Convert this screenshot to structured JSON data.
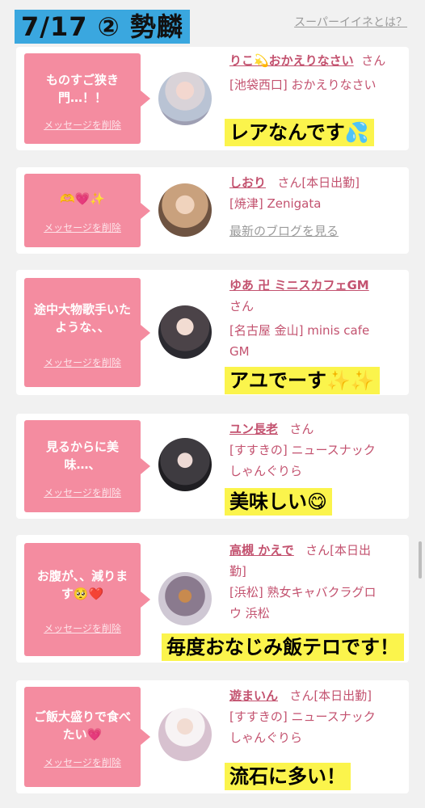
{
  "header": {
    "title": "7/17 ② 勢麟",
    "link": "スーパーイイネとは？"
  },
  "delete_label": "メッセージを削除",
  "cards": [
    {
      "message_lines": [
        "ものすご狭き",
        "門…！！"
      ],
      "name": "りこ💫おかえりなさい",
      "san": "さん",
      "shop_lines": [
        "[池袋西口] おかえりなさい"
      ],
      "blog": "",
      "highlight": "レアなんです💦"
    },
    {
      "message_lines": [
        "🫶💗✨"
      ],
      "name": "しおり",
      "san": "さん[本日出勤]",
      "shop_lines": [
        "[焼津] Zenigata"
      ],
      "blog": "最新のブログを見る",
      "highlight": ""
    },
    {
      "message_lines": [
        "途中大物歌手いた",
        "ような、、"
      ],
      "name": "ゆあ 卍 ミニスカフェGM",
      "san": "さん",
      "shop_lines": [
        "[名古屋 金山] minis cafe",
        "GM"
      ],
      "blog": "",
      "highlight": "アユでーす✨✨"
    },
    {
      "message_lines": [
        "見るからに美",
        "味…、"
      ],
      "name": "ユン長老",
      "san": "さん",
      "shop_lines": [
        "[すすきの] ニュースナック",
        "しゃんぐりら"
      ],
      "blog": "",
      "highlight": "美味しい😋"
    },
    {
      "message_lines": [
        "お腹が、、減りま",
        "す🥺❤️"
      ],
      "name": "高槻 かえで",
      "san": "さん[本日出",
      "san2": "勤]",
      "shop_lines": [
        "[浜松] 熟女キャバクラグロ",
        "ウ 浜松"
      ],
      "blog": "",
      "highlight": "毎度おなじみ飯テロです！"
    },
    {
      "message_lines": [
        "ご飯大盛りで食べ",
        "たい💗"
      ],
      "name": "遊まいん",
      "san": "さん[本日出勤]",
      "shop_lines": [
        "[すすきの] ニュースナック",
        "しゃんぐりら"
      ],
      "blog": "",
      "highlight": "流石に多い！"
    }
  ]
}
